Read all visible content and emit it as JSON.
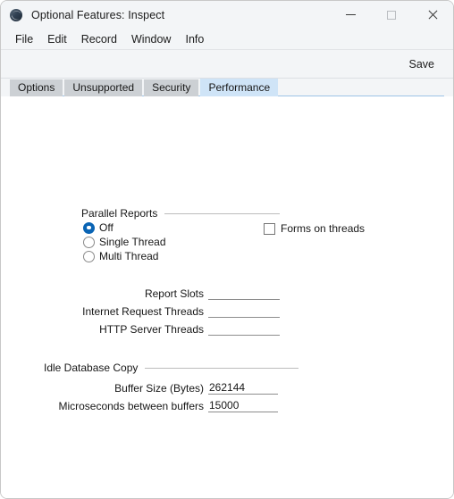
{
  "window": {
    "title": "Optional Features: Inspect",
    "icon": "app-swoosh-icon",
    "controls": {
      "minimize": "minimize-icon",
      "maximize": "maximize-icon",
      "close": "close-icon"
    }
  },
  "menubar": {
    "items": [
      {
        "label": "File"
      },
      {
        "label": "Edit"
      },
      {
        "label": "Record"
      },
      {
        "label": "Window"
      },
      {
        "label": "Info"
      }
    ]
  },
  "toolbar": {
    "save_label": "Save"
  },
  "tabs": [
    {
      "label": "Options",
      "active": false
    },
    {
      "label": "Unsupported",
      "active": false
    },
    {
      "label": "Security",
      "active": false
    },
    {
      "label": "Performance",
      "active": true
    }
  ],
  "main": {
    "parallel_reports": {
      "group_label": "Parallel Reports",
      "options": [
        {
          "label": "Off",
          "selected": true
        },
        {
          "label": "Single Thread",
          "selected": false
        },
        {
          "label": "Multi Thread",
          "selected": false
        }
      ]
    },
    "forms_on_threads": {
      "label": "Forms on threads",
      "checked": false
    },
    "thread_fields": [
      {
        "label": "Report Slots",
        "value": "",
        "placeholder": ""
      },
      {
        "label": "Internet Request Threads",
        "value": "",
        "placeholder": ""
      },
      {
        "label": "HTTP Server Threads",
        "value": "",
        "placeholder": ""
      }
    ],
    "idle_database_copy": {
      "group_label": "Idle Database Copy",
      "fields": [
        {
          "label": "Buffer Size (Bytes)",
          "value": "262144",
          "placeholder": ""
        },
        {
          "label": "Microseconds between buffers",
          "value": "15000",
          "placeholder": ""
        }
      ]
    }
  },
  "colors": {
    "titlebar_bg": "#f3f5f7",
    "active_tab_bg": "#cfe4f7",
    "inactive_tab_bg": "#ccd0d4",
    "tab_underline": "#9dc3e6",
    "radio_accent": "#0a64b4",
    "content_bg": "#ffffff",
    "text": "#171717"
  }
}
